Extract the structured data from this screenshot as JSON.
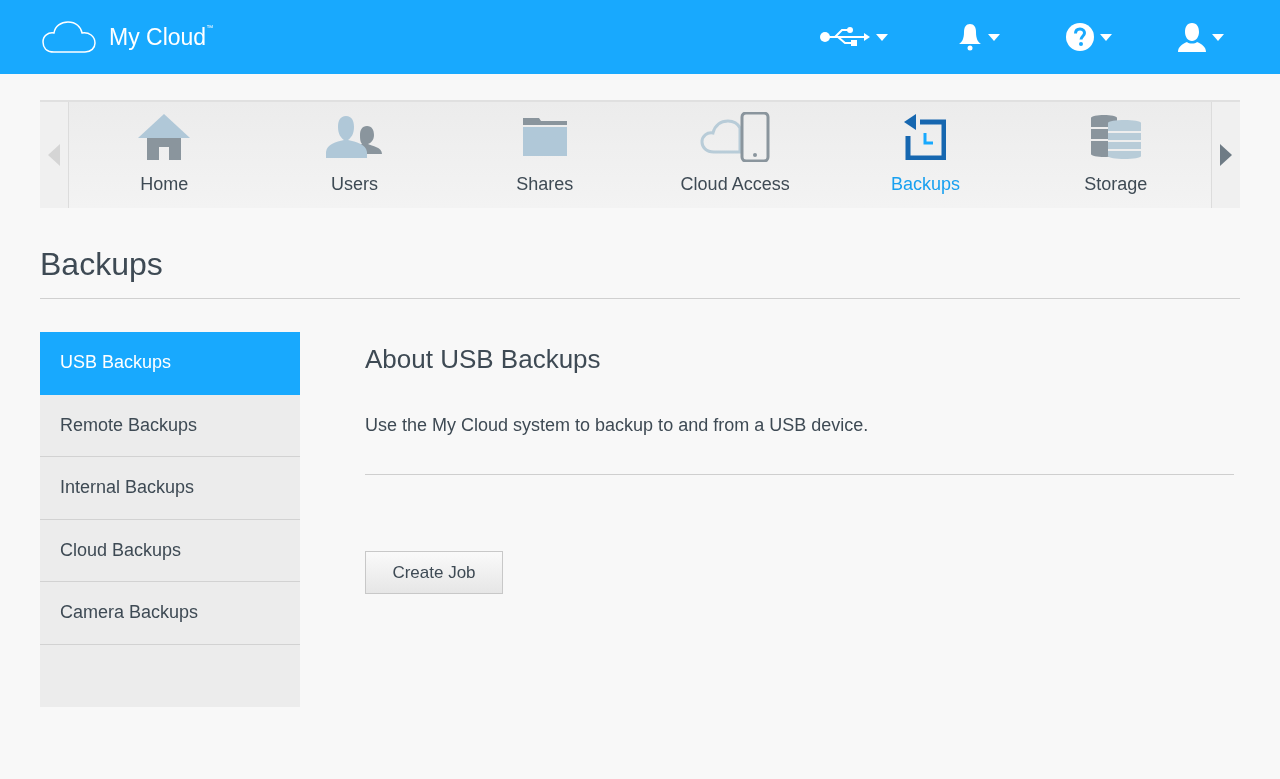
{
  "header": {
    "logo": "My Cloud$^{™}$",
    "icons": [
      {
        "kind": "usb"
      },
      {
        "kind": "bell"
      },
      {
        "kind": "help"
      },
      {
        "kind": "user"
      }
    ]
  },
  "nav": {
    "items": [
      {
        "label": "Home",
        "kind": "home",
        "selected": false
      },
      {
        "label": "Users",
        "kind": "users",
        "selected": false
      },
      {
        "label": "Shares",
        "kind": "shares",
        "selected": false
      },
      {
        "label": "Cloud Access",
        "kind": "cloud",
        "selected": false
      },
      {
        "label": "Backups",
        "kind": "backups",
        "selected": true
      },
      {
        "label": "Storage",
        "kind": "storage",
        "selected": false
      }
    ]
  },
  "page_title": "Backups",
  "sidebar": {
    "items": [
      {
        "label": "USB Backups",
        "selected": true
      },
      {
        "label": "Remote Backups",
        "selected": false
      },
      {
        "label": "Internal Backups",
        "selected": false
      },
      {
        "label": "Cloud Backups",
        "selected": false
      },
      {
        "label": "Camera Backups",
        "selected": false
      }
    ]
  },
  "content": {
    "heading": "About USB Backups",
    "description": "Use the My Cloud system to backup to and from a USB device.",
    "button": "Create Job"
  }
}
